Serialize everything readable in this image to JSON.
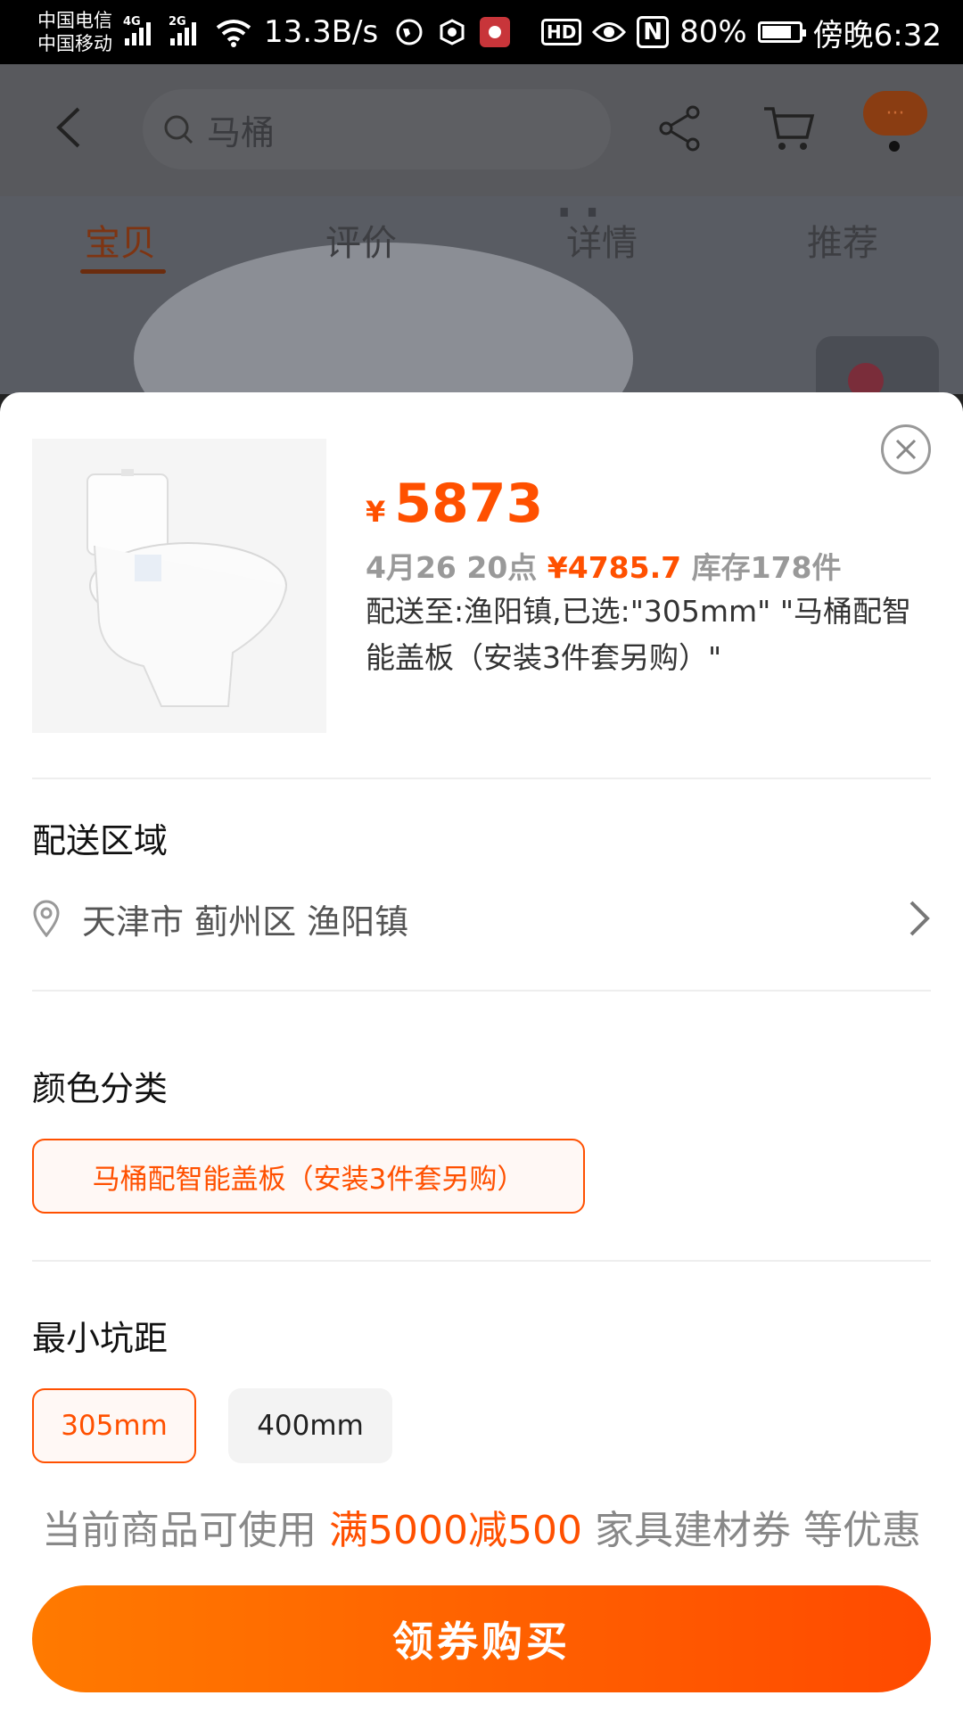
{
  "status_bar": {
    "carrier_1": "中国电信",
    "carrier_2": "中国移动",
    "sig1_type": "4G",
    "sig2_type": "2G",
    "net_speed": "13.3B/s",
    "hd": "HD",
    "nfc": "N",
    "battery_text": "80%",
    "battery_level": 0.8,
    "time": "傍晚6:32"
  },
  "header": {
    "search_query": "马桶",
    "more_label": "···",
    "tabs": [
      "宝贝",
      "评价",
      "详情",
      "推荐"
    ],
    "active_tab": 0
  },
  "sheet": {
    "currency": "¥",
    "price": "5873",
    "promo_date": "4月26 20点",
    "promo_price": "¥4785.7",
    "stock": "库存178件",
    "shipping_selected": "配送至:渔阳镇,已选:\"305mm\" \"马桶配智能盖板（安装3件套另购）\"",
    "delivery_title": "配送区域",
    "address": "天津市 蓟州区 渔阳镇",
    "color_title": "颜色分类",
    "color_option": "马桶配智能盖板（安装3件套另购）",
    "spacing_title": "最小坑距",
    "spacing_options": [
      "305mm",
      "400mm"
    ],
    "spacing_selected": 0,
    "coupon_prefix": "当前商品可使用",
    "coupon_highlight": "满5000减500",
    "coupon_suffix": "家具建材券 等优惠",
    "buy_button": "领券购买"
  },
  "colors": {
    "accent": "#ff5000",
    "button_gradient_start": "#ff7a00",
    "button_gradient_end": "#ff4a00"
  },
  "icons": [
    "back-arrow-icon",
    "search-icon",
    "share-icon",
    "cart-icon",
    "more-icon",
    "close-icon",
    "location-pin-icon",
    "chevron-right-icon",
    "heart-icon"
  ]
}
